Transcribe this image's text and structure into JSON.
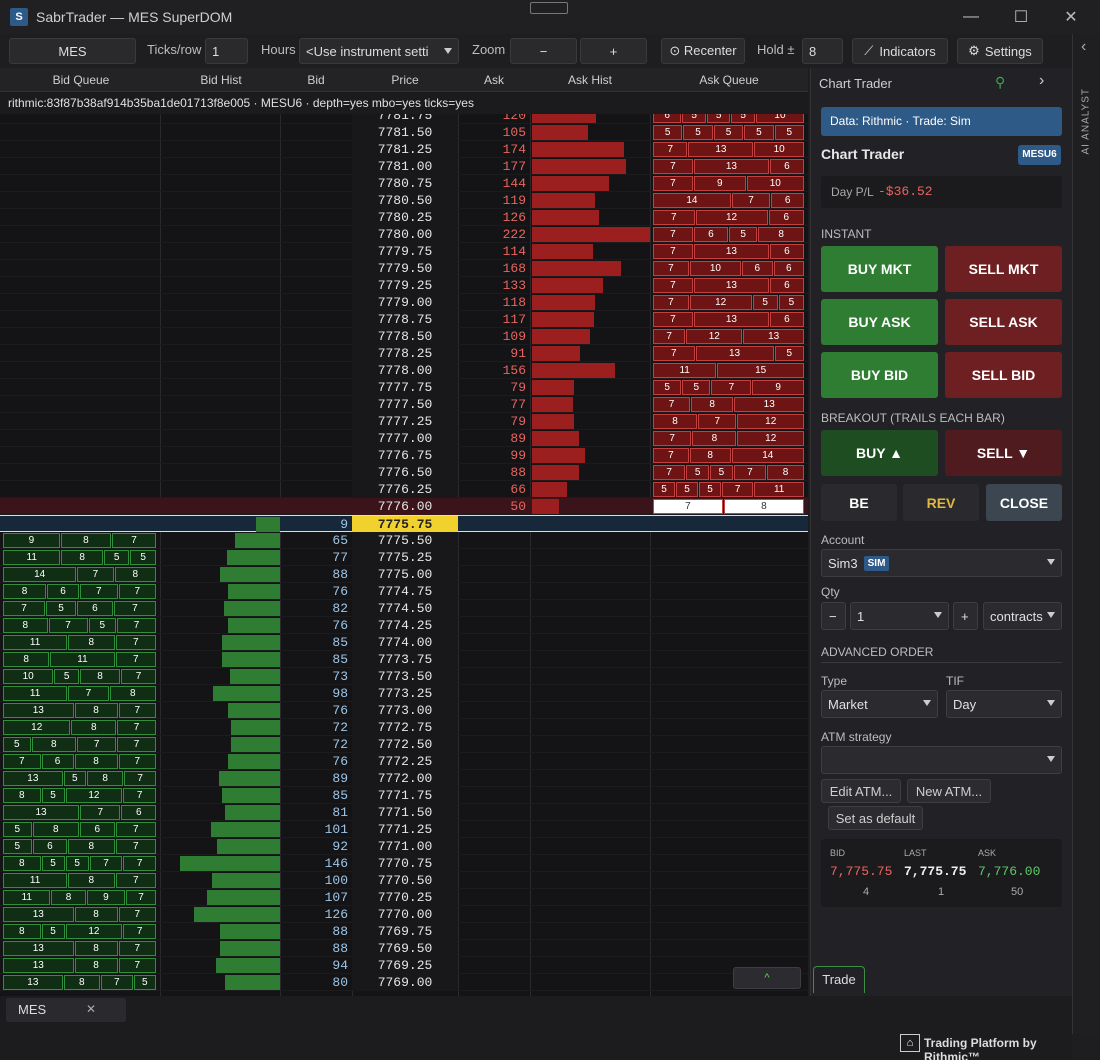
{
  "window": {
    "title": "SabrTrader — MES SuperDOM",
    "app_icon": "sabr-logo-icon",
    "minimize": "—",
    "maximize": "☐",
    "close": "✕"
  },
  "toolbar": {
    "instrument": "MES",
    "ticks_label": "Ticks/row",
    "ticks_value": "1",
    "hours_label": "Hours",
    "hours_value": "<Use instrument setti",
    "zoom_label": "Zoom",
    "zoom_minus": "−",
    "zoom_plus": "+",
    "recenter": "⊙ Recenter",
    "hold_label": "Hold ±",
    "hold_value": "8",
    "indicators": "Indicators",
    "settings": "Settings"
  },
  "headers": {
    "bid_queue": "Bid Queue",
    "bid_hist": "Bid Hist",
    "bid": "Bid",
    "price": "Price",
    "ask": "Ask",
    "ask_hist": "Ask Hist",
    "ask_queue": "Ask Queue"
  },
  "info_line": "rithmic:83f87b38af914b35ba1de01713f8e005 · MESU6 · depth=yes mbo=yes ticks=yes",
  "asks": [
    {
      "price": "7781.75",
      "size": "120",
      "q": [
        "6",
        "5",
        "5",
        "5",
        "10"
      ]
    },
    {
      "price": "7781.50",
      "size": "105",
      "q": [
        "5",
        "5",
        "5",
        "5",
        "5"
      ]
    },
    {
      "price": "7781.25",
      "size": "174",
      "q": [
        "7",
        "13",
        "10"
      ]
    },
    {
      "price": "7781.00",
      "size": "177",
      "q": [
        "7",
        "13",
        "6"
      ]
    },
    {
      "price": "7780.75",
      "size": "144",
      "q": [
        "7",
        "9",
        "10"
      ]
    },
    {
      "price": "7780.50",
      "size": "119",
      "q": [
        "14",
        "7",
        "6"
      ]
    },
    {
      "price": "7780.25",
      "size": "126",
      "q": [
        "7",
        "12",
        "6"
      ]
    },
    {
      "price": "7780.00",
      "size": "222",
      "q": [
        "7",
        "6",
        "5",
        "8"
      ]
    },
    {
      "price": "7779.75",
      "size": "114",
      "q": [
        "7",
        "13",
        "6"
      ]
    },
    {
      "price": "7779.50",
      "size": "168",
      "q": [
        "7",
        "10",
        "6",
        "6"
      ]
    },
    {
      "price": "7779.25",
      "size": "133",
      "q": [
        "7",
        "13",
        "6"
      ]
    },
    {
      "price": "7779.00",
      "size": "118",
      "q": [
        "7",
        "12",
        "5",
        "5"
      ]
    },
    {
      "price": "7778.75",
      "size": "117",
      "q": [
        "7",
        "13",
        "6"
      ]
    },
    {
      "price": "7778.50",
      "size": "109",
      "q": [
        "7",
        "12",
        "13"
      ]
    },
    {
      "price": "7778.25",
      "size": "91",
      "q": [
        "7",
        "13",
        "5"
      ]
    },
    {
      "price": "7778.00",
      "size": "156",
      "q": [
        "11",
        "15"
      ]
    },
    {
      "price": "7777.75",
      "size": "79",
      "q": [
        "5",
        "5",
        "7",
        "9"
      ]
    },
    {
      "price": "7777.50",
      "size": "77",
      "q": [
        "7",
        "8",
        "13"
      ]
    },
    {
      "price": "7777.25",
      "size": "79",
      "q": [
        "8",
        "7",
        "12"
      ]
    },
    {
      "price": "7777.00",
      "size": "89",
      "q": [
        "7",
        "8",
        "12"
      ]
    },
    {
      "price": "7776.75",
      "size": "99",
      "q": [
        "7",
        "8",
        "14"
      ]
    },
    {
      "price": "7776.50",
      "size": "88",
      "q": [
        "7",
        "5",
        "5",
        "7",
        "8"
      ]
    },
    {
      "price": "7776.25",
      "size": "66",
      "q": [
        "5",
        "5",
        "5",
        "7",
        "11"
      ]
    },
    {
      "price": "7776.00",
      "size": "50",
      "q": [
        "7",
        "8"
      ]
    }
  ],
  "inside": {
    "price": "7775.75",
    "bid": "9"
  },
  "bids": [
    {
      "price": "7775.50",
      "size": "65",
      "q": [
        "9",
        "8",
        "7"
      ]
    },
    {
      "price": "7775.25",
      "size": "77",
      "q": [
        "11",
        "8",
        "5",
        "5"
      ]
    },
    {
      "price": "7775.00",
      "size": "88",
      "q": [
        "14",
        "7",
        "8"
      ]
    },
    {
      "price": "7774.75",
      "size": "76",
      "q": [
        "8",
        "6",
        "7",
        "7"
      ]
    },
    {
      "price": "7774.50",
      "size": "82",
      "q": [
        "7",
        "5",
        "6",
        "7"
      ]
    },
    {
      "price": "7774.25",
      "size": "76",
      "q": [
        "8",
        "7",
        "5",
        "7"
      ]
    },
    {
      "price": "7774.00",
      "size": "85",
      "q": [
        "11",
        "8",
        "7"
      ]
    },
    {
      "price": "7773.75",
      "size": "85",
      "q": [
        "8",
        "11",
        "7"
      ]
    },
    {
      "price": "7773.50",
      "size": "73",
      "q": [
        "10",
        "5",
        "8",
        "7"
      ]
    },
    {
      "price": "7773.25",
      "size": "98",
      "q": [
        "11",
        "7",
        "8"
      ]
    },
    {
      "price": "7773.00",
      "size": "76",
      "q": [
        "13",
        "8",
        "7"
      ]
    },
    {
      "price": "7772.75",
      "size": "72",
      "q": [
        "12",
        "8",
        "7"
      ]
    },
    {
      "price": "7772.50",
      "size": "72",
      "q": [
        "5",
        "8",
        "7",
        "7"
      ]
    },
    {
      "price": "7772.25",
      "size": "76",
      "q": [
        "7",
        "6",
        "8",
        "7"
      ]
    },
    {
      "price": "7772.00",
      "size": "89",
      "q": [
        "13",
        "5",
        "8",
        "7"
      ]
    },
    {
      "price": "7771.75",
      "size": "85",
      "q": [
        "8",
        "5",
        "12",
        "7"
      ]
    },
    {
      "price": "7771.50",
      "size": "81",
      "q": [
        "13",
        "7",
        "6"
      ]
    },
    {
      "price": "7771.25",
      "size": "101",
      "q": [
        "5",
        "8",
        "6",
        "7"
      ]
    },
    {
      "price": "7771.00",
      "size": "92",
      "q": [
        "5",
        "6",
        "8",
        "7"
      ]
    },
    {
      "price": "7770.75",
      "size": "146",
      "q": [
        "8",
        "5",
        "5",
        "7",
        "7"
      ]
    },
    {
      "price": "7770.50",
      "size": "100",
      "q": [
        "11",
        "8",
        "7"
      ]
    },
    {
      "price": "7770.25",
      "size": "107",
      "q": [
        "11",
        "8",
        "9",
        "7"
      ]
    },
    {
      "price": "7770.00",
      "size": "126",
      "q": [
        "13",
        "8",
        "7"
      ]
    },
    {
      "price": "7769.75",
      "size": "88",
      "q": [
        "8",
        "5",
        "12",
        "7"
      ]
    },
    {
      "price": "7769.50",
      "size": "88",
      "q": [
        "13",
        "8",
        "7"
      ]
    },
    {
      "price": "7769.25",
      "size": "94",
      "q": [
        "13",
        "8",
        "7"
      ]
    },
    {
      "price": "7769.00",
      "size": "80",
      "q": [
        "13",
        "8",
        "7",
        "5"
      ]
    }
  ],
  "panel": {
    "title": "Chart Trader",
    "pin_icon": "pin-icon",
    "data_badge": "Data: Rithmic · Trade: Sim",
    "subtitle": "Chart Trader",
    "symbol": "MESU6",
    "pl_label": "Day P/L",
    "pl_value": "-$36.52",
    "instant": "INSTANT",
    "buy_mkt": "BUY MKT",
    "sell_mkt": "SELL MKT",
    "buy_ask": "BUY ASK",
    "sell_ask": "SELL ASK",
    "buy_bid": "BUY BID",
    "sell_bid": "SELL BID",
    "breakout": "BREAKOUT (TRAILS EACH BAR)",
    "buy_up": "BUY ▲",
    "sell_down": "SELL ▼",
    "be": "BE",
    "rev": "REV",
    "close": "CLOSE",
    "account_label": "Account",
    "account": "Sim3",
    "sim_badge": "SIM",
    "qty_label": "Qty",
    "qty_minus": "−",
    "qty": "1",
    "qty_plus": "+",
    "units": "contracts",
    "advanced": "ADVANCED ORDER",
    "type_label": "Type",
    "type": "Market",
    "tif_label": "TIF",
    "tif": "Day",
    "atm_label": "ATM strategy",
    "atm": "",
    "edit_atm": "Edit ATM...",
    "new_atm": "New ATM...",
    "set_default": "Set as default",
    "bid_label": "BID",
    "bid": "7,775.75",
    "bid_size": "4",
    "last_label": "LAST",
    "last": "7,775.75",
    "last_size": "1",
    "ask_label": "ASK",
    "ask": "7,776.00",
    "ask_size": "50",
    "trade_tab": "Trade"
  },
  "sidebar": {
    "label": "AI ANALYST",
    "chevron": "‹"
  },
  "bottom": {
    "tab": "MES",
    "tab_close": "✕",
    "scroll_up": "^",
    "brand": "Trading Platform by Rithmic™"
  },
  "colors": {
    "ask_bar": "#9b1f1f",
    "bid_bar": "#2e7d32",
    "buy": "#2e7d32",
    "sell": "#7a1f22",
    "accent": "#2d5a87"
  }
}
